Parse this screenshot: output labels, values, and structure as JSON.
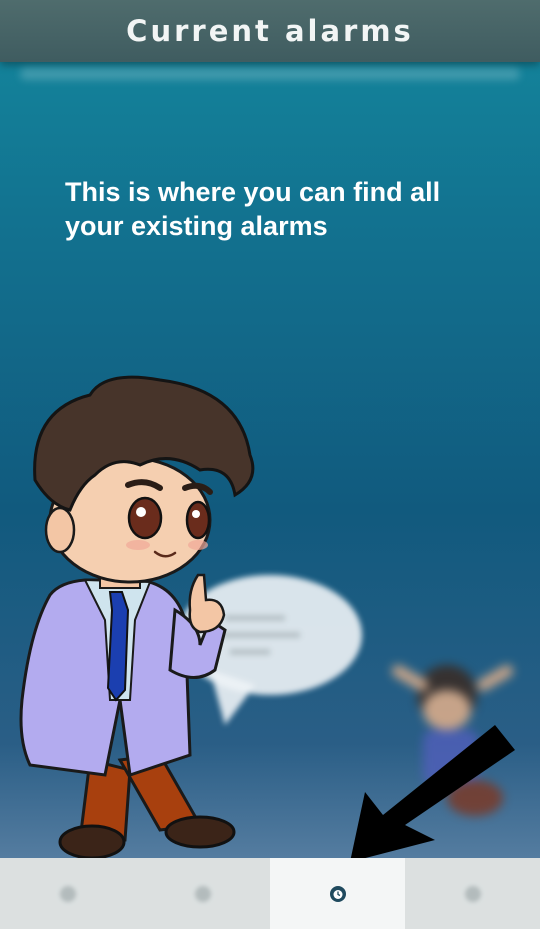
{
  "header": {
    "title": "Current alarms"
  },
  "tutorial": {
    "message": "This is where you can find all your existing alarms"
  },
  "bottom_nav": {
    "items": [
      {
        "icon": "alarm-icon",
        "active": false
      },
      {
        "icon": "calendar-icon",
        "active": false
      },
      {
        "icon": "current-alarms-icon",
        "active": true
      },
      {
        "icon": "settings-icon",
        "active": false
      }
    ]
  },
  "colors": {
    "header_bg": "#4f6c6d",
    "background_top": "#14889e",
    "background_bottom": "#2a5e86",
    "nav_bg": "#e8ecec",
    "active_icon": "#1f4a5e",
    "arrow": "#000000"
  }
}
